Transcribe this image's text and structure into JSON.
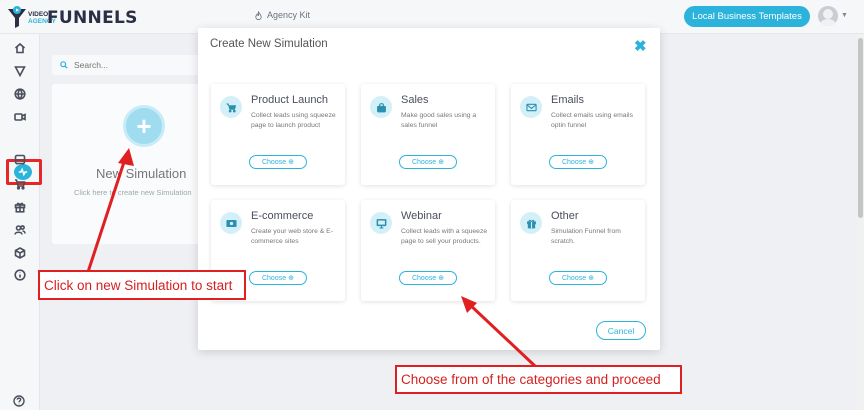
{
  "header": {
    "logo_small_top": "VIDEO",
    "logo_small_bottom": "AGENCY",
    "logo_big": "FUNNELS",
    "agency_kit": "Agency Kit",
    "templates_button": "Local Business Templates"
  },
  "sidebar": {
    "icons": [
      "home-icon",
      "funnel-icon",
      "globe-icon",
      "video-icon",
      "simulation-icon",
      "bus-icon",
      "cart-icon",
      "gift-icon",
      "users-icon",
      "box-icon",
      "info-icon",
      "help-icon"
    ]
  },
  "background": {
    "search_placeholder": "Search...",
    "new_sim_title": "New Simulation",
    "new_sim_desc": "Click here to create new Simulation"
  },
  "modal": {
    "title": "Create New Simulation",
    "close_symbol": "✖",
    "cancel_label": "Cancel",
    "choose_label": "Choose",
    "cards": [
      {
        "title": "Product Launch",
        "desc": "Collect leads using squeeze page to launch product",
        "icon": "cart-icon"
      },
      {
        "title": "Sales",
        "desc": "Make good sales using a sales funnel",
        "icon": "bag-icon"
      },
      {
        "title": "Emails",
        "desc": "Collect emails using emails optin funnel",
        "icon": "mail-icon"
      },
      {
        "title": "E-commerce",
        "desc": "Create your web store & E-commerce sites",
        "icon": "money-icon"
      },
      {
        "title": "Webinar",
        "desc": "Collect leads with a squeeze page to sell your products.",
        "icon": "monitor-icon"
      },
      {
        "title": "Other",
        "desc": "Simulation Funnel from scratch.",
        "icon": "gift-icon"
      }
    ]
  },
  "annotations": {
    "start": "Click on new Simulation to start",
    "choose": "Choose from of the categories and proceed"
  },
  "colors": {
    "accent": "#2cb3dc",
    "annotation": "#e02020"
  }
}
